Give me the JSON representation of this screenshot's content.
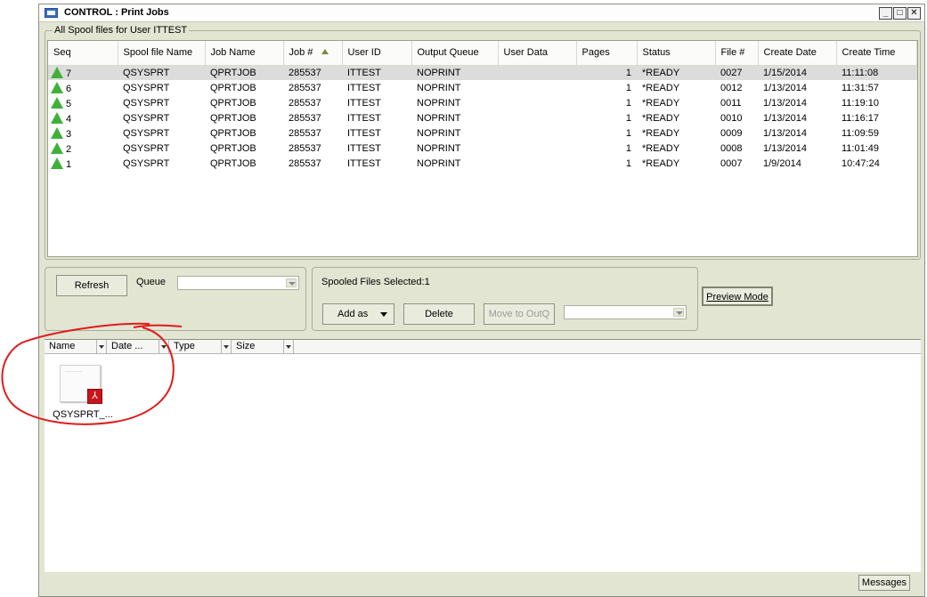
{
  "window": {
    "title": "CONTROL : Print Jobs",
    "minimize": "_",
    "maximize": "□",
    "close": "✕"
  },
  "spool_group": {
    "title": "All Spool files for User ITTEST",
    "columns": [
      "Seq",
      "Spool file Name",
      "Job Name",
      "Job #",
      "User ID",
      "Output Queue",
      "User Data",
      "Pages",
      "Status",
      "File #",
      "Create Date",
      "Create Time"
    ],
    "rows": [
      [
        "7",
        "QSYSPRT",
        "QPRTJOB",
        "285537",
        "ITTEST",
        "NOPRINT",
        "",
        "1",
        "*READY",
        "0027",
        "1/15/2014",
        "11:11:08"
      ],
      [
        "6",
        "QSYSPRT",
        "QPRTJOB",
        "285537",
        "ITTEST",
        "NOPRINT",
        "",
        "1",
        "*READY",
        "0012",
        "1/13/2014",
        "11:31:57"
      ],
      [
        "5",
        "QSYSPRT",
        "QPRTJOB",
        "285537",
        "ITTEST",
        "NOPRINT",
        "",
        "1",
        "*READY",
        "0011",
        "1/13/2014",
        "11:19:10"
      ],
      [
        "4",
        "QSYSPRT",
        "QPRTJOB",
        "285537",
        "ITTEST",
        "NOPRINT",
        "",
        "1",
        "*READY",
        "0010",
        "1/13/2014",
        "11:16:17"
      ],
      [
        "3",
        "QSYSPRT",
        "QPRTJOB",
        "285537",
        "ITTEST",
        "NOPRINT",
        "",
        "1",
        "*READY",
        "0009",
        "1/13/2014",
        "11:09:59"
      ],
      [
        "2",
        "QSYSPRT",
        "QPRTJOB",
        "285537",
        "ITTEST",
        "NOPRINT",
        "",
        "1",
        "*READY",
        "0008",
        "1/13/2014",
        "11:01:49"
      ],
      [
        "1",
        "QSYSPRT",
        "QPRTJOB",
        "285537",
        "ITTEST",
        "NOPRINT",
        "",
        "1",
        "*READY",
        "0007",
        "1/9/2014",
        "10:47:24"
      ]
    ]
  },
  "controls": {
    "refresh_label": "Refresh",
    "queue_label": "Queue",
    "queue_value": "",
    "selected_label": "Spooled Files Selected:",
    "selected_count": "1",
    "add_as_label": "Add as",
    "delete_label": "Delete",
    "move_label": "Move to OutQ",
    "outq_value": "",
    "preview_label": "Preview Mode"
  },
  "file_browser": {
    "columns": [
      "Name",
      "Date ...",
      "Type",
      "Size"
    ],
    "files": [
      {
        "name": "QSYSPRT_...",
        "icon": "pdf-file-icon"
      }
    ]
  },
  "status": {
    "messages_label": "Messages"
  },
  "colors": {
    "window_bg": "#e1e5d2",
    "status_ok": "#3fb13a",
    "annotation": "#e01b1b",
    "pdf": "#c9141a"
  }
}
